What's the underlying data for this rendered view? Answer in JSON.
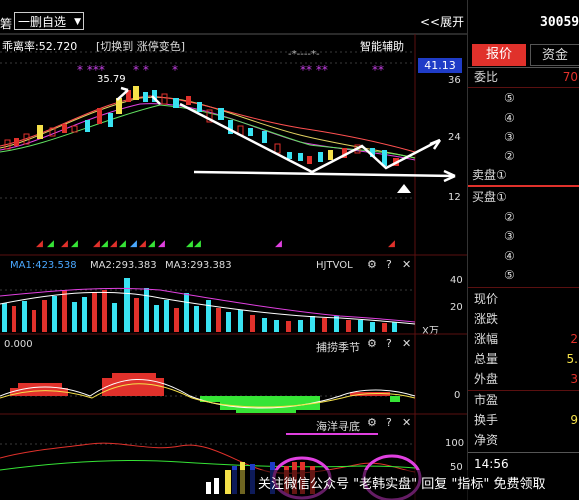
{
  "header": {
    "title_fragment": "箬",
    "selector_label": "一删自选",
    "expand_label": "<<展开",
    "stock_code_fragment": "30059"
  },
  "main_panel": {
    "indicator_label": "乖离率:52.720",
    "switch_label": "[切换到 涨停变色]",
    "assist_label": "智能辅助",
    "price_box": "41.13",
    "high_label": "35.79",
    "y_ticks": [
      "36",
      "24",
      "12"
    ]
  },
  "vol_panel": {
    "ma1": "MA1:423.538",
    "ma2": "MA2:293.383",
    "ma3": "MA3:293.383",
    "name": "HJTVOL",
    "y_ticks": [
      "40",
      "20"
    ],
    "unit": "X万"
  },
  "season_panel": {
    "left_label": "0.000",
    "name": "捕捞季节",
    "y_tick": "0"
  },
  "sea_panel": {
    "name": "海洋寻底",
    "y_ticks": [
      "100",
      "50"
    ]
  },
  "side": {
    "tabs": [
      "报价",
      "资金"
    ],
    "commission_label": "委比",
    "commission_value": "70",
    "sell_rows": [
      "⑤",
      "④",
      "③",
      "②",
      "卖盘①"
    ],
    "buy_rows": [
      "买盘①",
      "②",
      "③",
      "④",
      "⑤"
    ],
    "stats": [
      {
        "label": "现价",
        "value": ""
      },
      {
        "label": "涨跌",
        "value": ""
      },
      {
        "label": "涨幅",
        "value": "2"
      },
      {
        "label": "总量",
        "value": "5."
      },
      {
        "label": "外盘",
        "value": "3"
      },
      {
        "label": "市盈",
        "value": ""
      },
      {
        "label": "换手",
        "value": "9"
      },
      {
        "label": "净资",
        "value": ""
      }
    ],
    "time": "14:56"
  },
  "watermark": "关注微信公众号 \"老韩实盘\" 回复 \"指标\" 免费领取",
  "colors": {
    "up": "#e0312b",
    "down": "#39e3f2",
    "yellow": "#f5e14a",
    "green": "#36e436",
    "magenta": "#e040e0",
    "blue_box": "#1f3cc7"
  }
}
